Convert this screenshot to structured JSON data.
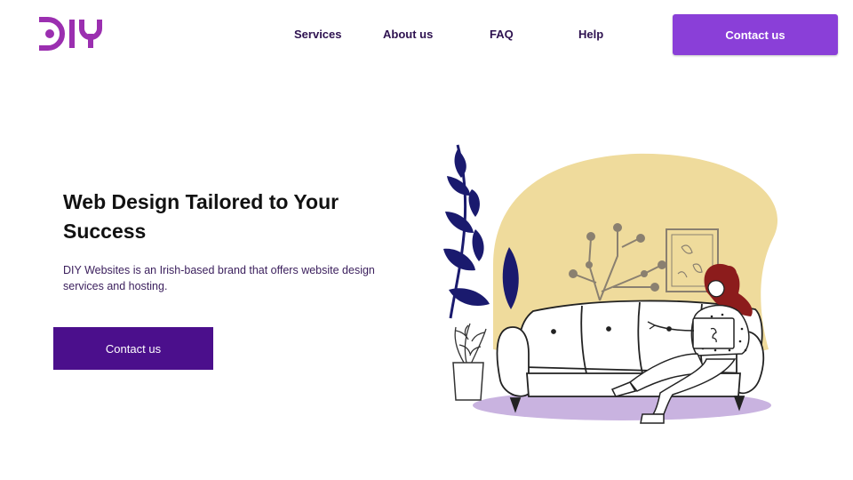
{
  "brand": {
    "logo_text": "DIY",
    "accent": "#9b2fb0"
  },
  "nav": {
    "items": [
      {
        "label": "Services"
      },
      {
        "label": "About us"
      },
      {
        "label": "FAQ"
      },
      {
        "label": "Help"
      }
    ],
    "cta_label": "Contact us"
  },
  "hero": {
    "title": "Web Design Tailored to Your Success",
    "description": "DIY Websites is an Irish-based brand that offers website design services and hosting.",
    "cta_label": "Contact us"
  },
  "colors": {
    "header_button": "#8a3fd8",
    "hero_button": "#4b0f8c",
    "nav_text": "#2e1250",
    "blob_yellow": "#efdb9c",
    "floor_lavender": "#c9b3e0",
    "plant_navy": "#1a1a6e"
  }
}
